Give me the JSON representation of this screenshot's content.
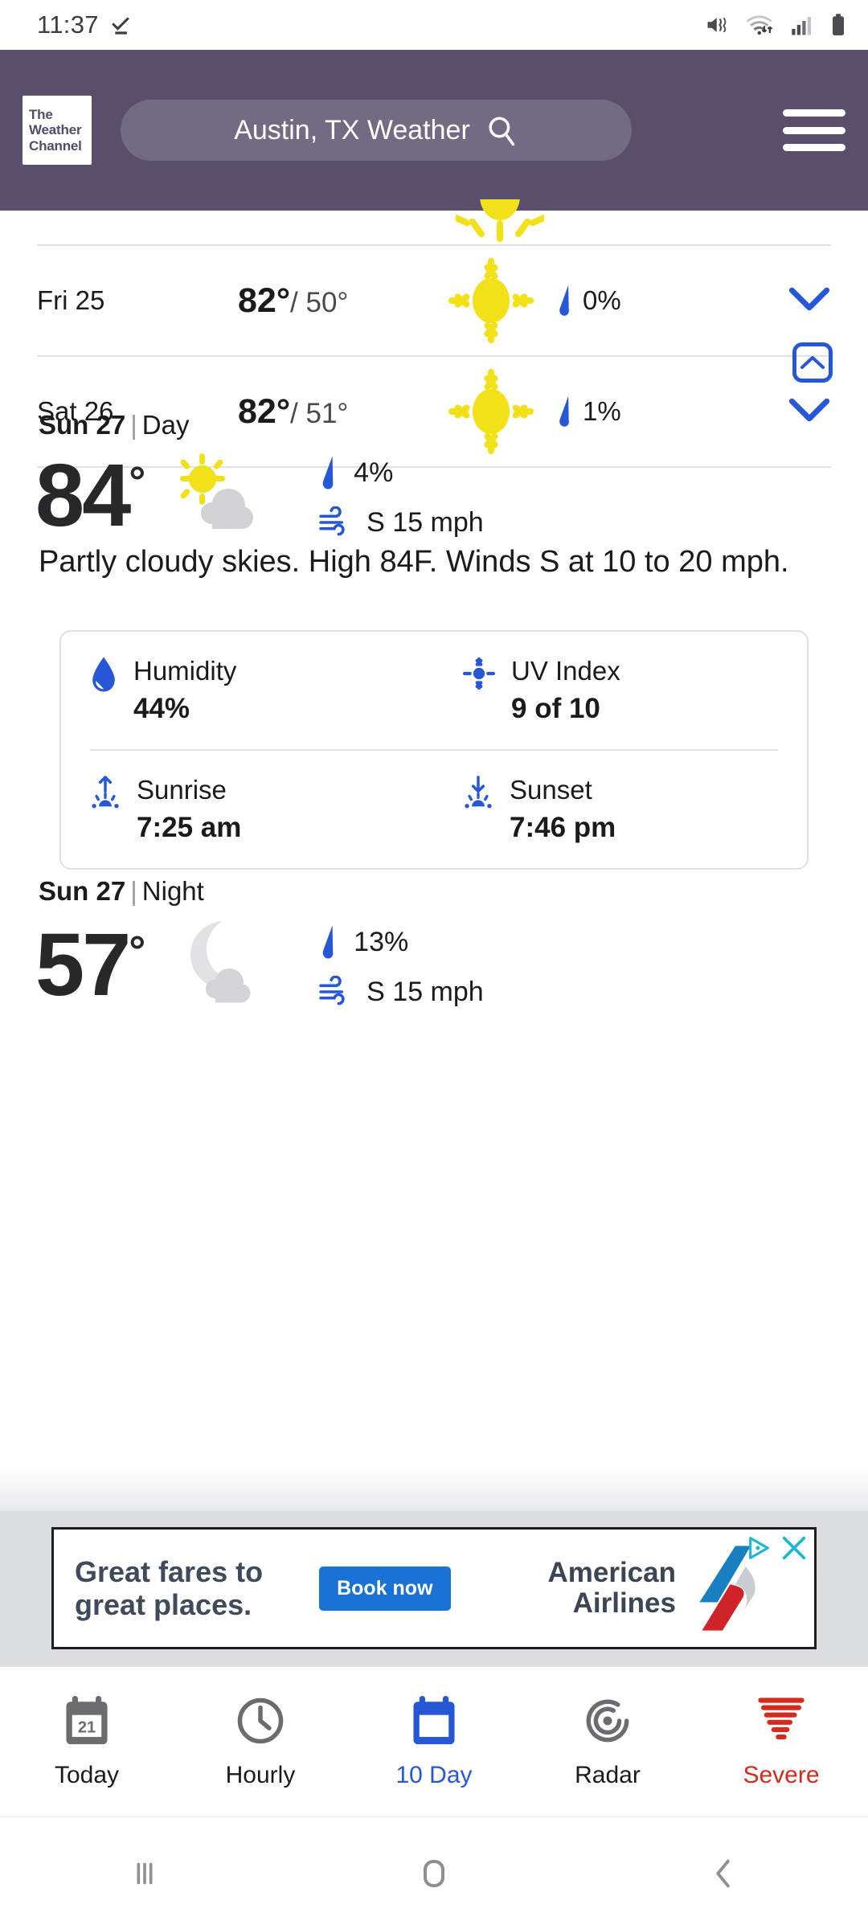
{
  "status_bar": {
    "time": "11:37",
    "icons": [
      "checkmark-icon",
      "mute-vibrate-icon",
      "wifi-icon",
      "cellular-signal-icon",
      "battery-icon"
    ]
  },
  "header": {
    "logo_lines": [
      "The",
      "Weather",
      "Channel"
    ],
    "search_value": "Austin, TX Weather",
    "search_icon": "search-icon",
    "menu_icon": "hamburger-menu-icon",
    "background_color": "#594f6d"
  },
  "forecast_rows": [
    {
      "day": "Fri 25",
      "high": "82°",
      "low": "/ 50°",
      "icon": "sunny-icon",
      "precip": "0%",
      "chevron": "chevron-down-icon"
    },
    {
      "day": "Sat 26",
      "high": "82°",
      "low": "/ 51°",
      "icon": "sunny-icon",
      "precip": "1%",
      "chevron": "chevron-down-icon"
    }
  ],
  "scroll_top_button": {
    "icon": "chevron-up-icon",
    "color": "#2557d6"
  },
  "day_section": {
    "title_day": "Sun 27",
    "title_sep": "|",
    "title_period": "Day",
    "temperature": "84",
    "degree": "°",
    "condition_icon": "partly-cloudy-day-icon",
    "precip_label": "4%",
    "wind_label": "S 15 mph",
    "narrative": "Partly cloudy skies. High 84F. Winds S at 10 to 20 mph.",
    "details": [
      {
        "icon": "humidity-droplet-icon",
        "label": "Humidity",
        "value": "44%"
      },
      {
        "icon": "uv-sun-icon",
        "label": "UV Index",
        "value": "9 of 10"
      },
      {
        "icon": "sunrise-icon",
        "label": "Sunrise",
        "value": "7:25 am"
      },
      {
        "icon": "sunset-icon",
        "label": "Sunset",
        "value": "7:46 pm"
      }
    ]
  },
  "night_section": {
    "title_day": "Sun 27",
    "title_sep": "|",
    "title_period": "Night",
    "temperature": "57",
    "degree": "°",
    "condition_icon": "partly-cloudy-night-icon",
    "precip_label": "13%",
    "wind_label": "S 15 mph"
  },
  "ad": {
    "headline_line1": "Great fares to",
    "headline_line2": "great places.",
    "cta": "Book now",
    "brand_line1": "American",
    "brand_line2": "Airlines",
    "ad_choices_icon": "ad-choices-icon",
    "close_icon": "close-icon"
  },
  "bottom_tabs": [
    {
      "label": "Today",
      "icon": "calendar-today-icon",
      "active": false,
      "color": "#6b6b70"
    },
    {
      "label": "Hourly",
      "icon": "clock-icon",
      "active": false,
      "color": "#6b6b70"
    },
    {
      "label": "10 Day",
      "icon": "calendar-blue-icon",
      "active": true,
      "color": "#2557d6"
    },
    {
      "label": "Radar",
      "icon": "radar-icon",
      "active": false,
      "color": "#6b6b70"
    },
    {
      "label": "Severe",
      "icon": "severe-tornado-icon",
      "active": false,
      "color": "#d52b1e"
    }
  ],
  "system_nav": {
    "recents_icon": "recents-icon",
    "home_icon": "home-icon",
    "back_icon": "back-icon"
  }
}
